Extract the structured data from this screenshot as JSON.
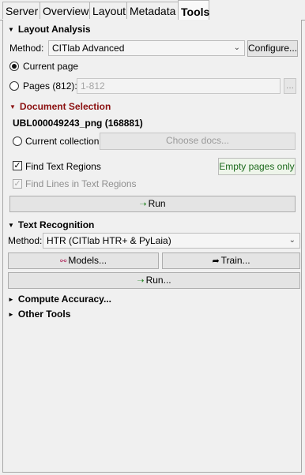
{
  "tabs": [
    {
      "label": "Server",
      "active": false
    },
    {
      "label": "Overview",
      "active": false
    },
    {
      "label": "Layout",
      "active": false
    },
    {
      "label": "Metadata",
      "active": false
    },
    {
      "label": "Tools",
      "active": true
    }
  ],
  "layout_analysis": {
    "title": "Layout Analysis",
    "method_label": "Method:",
    "method_value": "CITlab Advanced",
    "configure_label": "Configure...",
    "current_page_label": "Current page",
    "pages_label": "Pages (812):",
    "pages_placeholder": "1-812",
    "pages_button_label": "..."
  },
  "document_selection": {
    "title": "Document Selection",
    "document_name": "UBL000049243_png (168881)",
    "current_collection_label": "Current collection",
    "choose_docs_label": "Choose docs...",
    "find_text_regions_label": "Find Text Regions",
    "empty_pages_label": "Empty pages only",
    "find_lines_label": "Find Lines in Text Regions",
    "run_label": "Run"
  },
  "text_recognition": {
    "title": "Text Recognition",
    "method_label": "Method:",
    "method_value": "HTR (CITlab HTR+ & PyLaia)",
    "models_label": "Models...",
    "train_label": "Train...",
    "run_label": "Run..."
  },
  "compute_accuracy": {
    "title": "Compute Accuracy..."
  },
  "other_tools": {
    "title": "Other Tools"
  },
  "colors": {
    "section_red": "#8b1010",
    "accent_green": "#2e8b2e"
  }
}
